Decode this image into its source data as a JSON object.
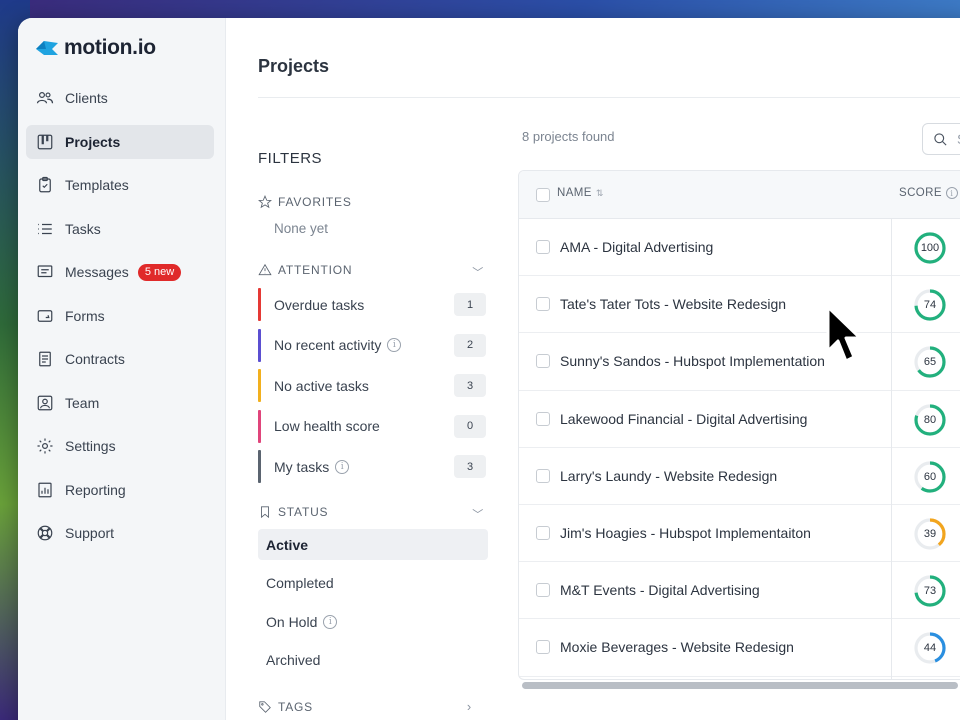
{
  "app": {
    "logo_text": "motion.io",
    "brand_color": "#1fa3e0"
  },
  "sidebar": {
    "items": [
      {
        "label": "Clients",
        "icon": "users-icon"
      },
      {
        "label": "Projects",
        "icon": "kanban-icon",
        "active": true
      },
      {
        "label": "Templates",
        "icon": "clipboard-icon"
      },
      {
        "label": "Tasks",
        "icon": "list-icon"
      },
      {
        "label": "Messages",
        "icon": "message-icon",
        "badge": "5 new"
      },
      {
        "label": "Forms",
        "icon": "form-icon"
      },
      {
        "label": "Contracts",
        "icon": "document-icon"
      },
      {
        "label": "Team",
        "icon": "team-icon"
      },
      {
        "label": "Settings",
        "icon": "gear-icon"
      },
      {
        "label": "Reporting",
        "icon": "report-icon"
      },
      {
        "label": "Support",
        "icon": "lifebuoy-icon"
      }
    ]
  },
  "main": {
    "title": "Projects",
    "found_text": "8 projects found",
    "search_placeholder": "Se"
  },
  "filters": {
    "title": "FILTERS",
    "favorites": {
      "label": "FAVORITES",
      "empty_text": "None yet"
    },
    "attention": {
      "label": "ATTENTION",
      "items": [
        {
          "label": "Overdue tasks",
          "count": "1",
          "color": "#e53935",
          "info": false
        },
        {
          "label": "No recent activity",
          "count": "2",
          "color": "#5b4fd1",
          "info": true
        },
        {
          "label": "No active tasks",
          "count": "3",
          "color": "#f2b01e",
          "info": false
        },
        {
          "label": "Low health score",
          "count": "0",
          "color": "#e0457b",
          "info": false
        },
        {
          "label": "My tasks",
          "count": "3",
          "color": "#5b6470",
          "info": true
        }
      ]
    },
    "status": {
      "label": "STATUS",
      "items": [
        {
          "label": "Active",
          "active": true
        },
        {
          "label": "Completed"
        },
        {
          "label": "On Hold",
          "info": true
        },
        {
          "label": "Archived"
        }
      ]
    },
    "tags": {
      "label": "TAGS"
    }
  },
  "table": {
    "columns": {
      "name": "NAME",
      "score": "SCORE"
    },
    "rows": [
      {
        "name": "AMA - Digital Advertising",
        "score": 100,
        "color": "#22b07d"
      },
      {
        "name": "Tate's Tater Tots - Website Redesign",
        "score": 74,
        "color": "#22b07d"
      },
      {
        "name": "Sunny's Sandos - Hubspot Implementation",
        "score": 65,
        "color": "#22b07d"
      },
      {
        "name": "Lakewood Financial - Digital Advertising",
        "score": 80,
        "color": "#22b07d"
      },
      {
        "name": "Larry's Laundy - Website Redesign",
        "score": 60,
        "color": "#22b07d"
      },
      {
        "name": "Jim's Hoagies - Hubspot Implementaiton",
        "score": 39,
        "color": "#f2a51e"
      },
      {
        "name": "M&T Events - Digital Advertising",
        "score": 73,
        "color": "#22b07d"
      },
      {
        "name": "Moxie Beverages - Website Redesign",
        "score": 44,
        "color": "#2a8fe0"
      }
    ]
  }
}
